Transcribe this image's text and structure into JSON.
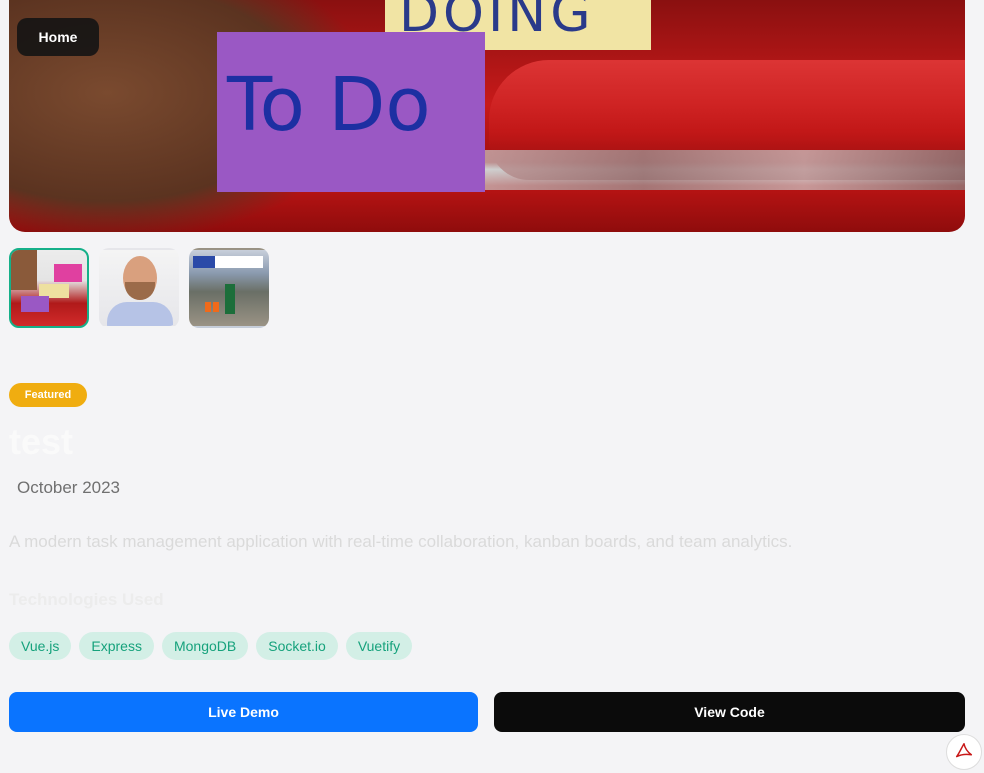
{
  "hero": {
    "note_doing": "DOING",
    "note_todo": "To Do",
    "home_label": "Home"
  },
  "gallery": {
    "selected_index": 0,
    "thumbnails": [
      {
        "name": "kanban-notes-thumbnail"
      },
      {
        "name": "portrait-thumbnail"
      },
      {
        "name": "race-thumbnail"
      }
    ]
  },
  "project": {
    "badge": "Featured",
    "title": "test",
    "date": "October 2023",
    "description": "A modern task management application with real-time collaboration, kanban boards, and team analytics.",
    "tech_heading": "Technologies Used",
    "tags": [
      "Vue.js",
      "Express",
      "MongoDB",
      "Socket.io",
      "Vuetify"
    ]
  },
  "actions": {
    "live_demo": "Live Demo",
    "view_code": "View Code"
  },
  "icons": {
    "pdf": "pdf-icon"
  },
  "colors": {
    "accent_blue": "#0a74ff",
    "badge_yellow": "#f0ad10",
    "tag_green": "#16a27c",
    "tag_bg": "#d3efe6"
  }
}
